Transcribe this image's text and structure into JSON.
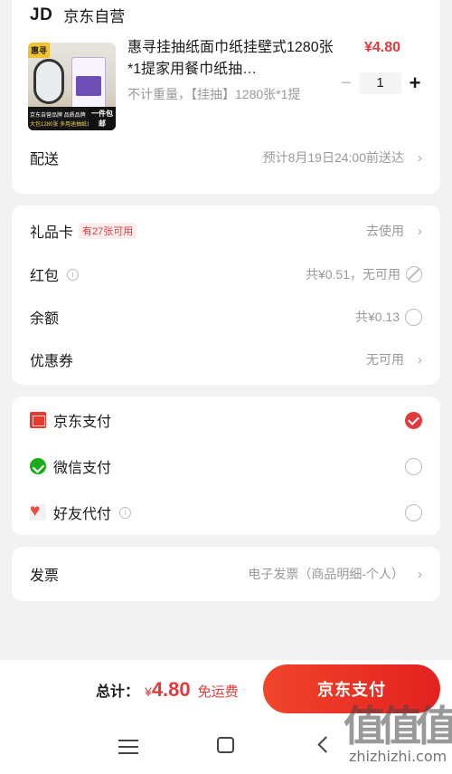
{
  "store": {
    "logo": "JD",
    "name": "京东自营"
  },
  "product": {
    "thumb_brand": "惠寻",
    "thumb_strip_line1": "京东自营品牌 品质品牌",
    "thumb_strip_line2": "大包1280张 多用途抽纸1提",
    "thumb_badge": "一件包邮",
    "title": "惠寻挂抽纸面巾纸挂壁式1280张*1提家用餐巾纸抽…",
    "spec": "不计重量，【挂抽】1280张*1提",
    "price": "¥4.80",
    "quantity": "1",
    "minus_label": "−",
    "plus_label": "+"
  },
  "delivery": {
    "label": "配送",
    "value": "预计8月19日24:00前送达"
  },
  "benefits": {
    "gift_card": {
      "label": "礼品卡",
      "badge": "有27张可用",
      "value": "去使用"
    },
    "red_packet": {
      "label": "红包",
      "value": "共¥0.51，无可用"
    },
    "balance": {
      "label": "余额",
      "value": "共¥0.13"
    },
    "coupon": {
      "label": "优惠券",
      "value": "无可用"
    }
  },
  "payment": {
    "methods": [
      {
        "label": "京东支付",
        "icon": "jd-pay-icon",
        "selected": true
      },
      {
        "label": "微信支付",
        "icon": "wechat-icon",
        "selected": false
      },
      {
        "label": "好友代付",
        "icon": "friend-pay-icon",
        "selected": false
      }
    ]
  },
  "invoice": {
    "label": "发票",
    "value": "电子发票（商品明细-个人）"
  },
  "footer": {
    "total_label": "总计：",
    "currency": "¥",
    "total_amount": "4.80",
    "shipping_note": "免运费",
    "pay_button": "京东支付"
  },
  "watermark": {
    "big": "值值值",
    "small": "zhizhizhi.com"
  },
  "colors": {
    "accent": "#e4393c",
    "secondary_text": "#999999",
    "background": "#f2f2f2"
  }
}
